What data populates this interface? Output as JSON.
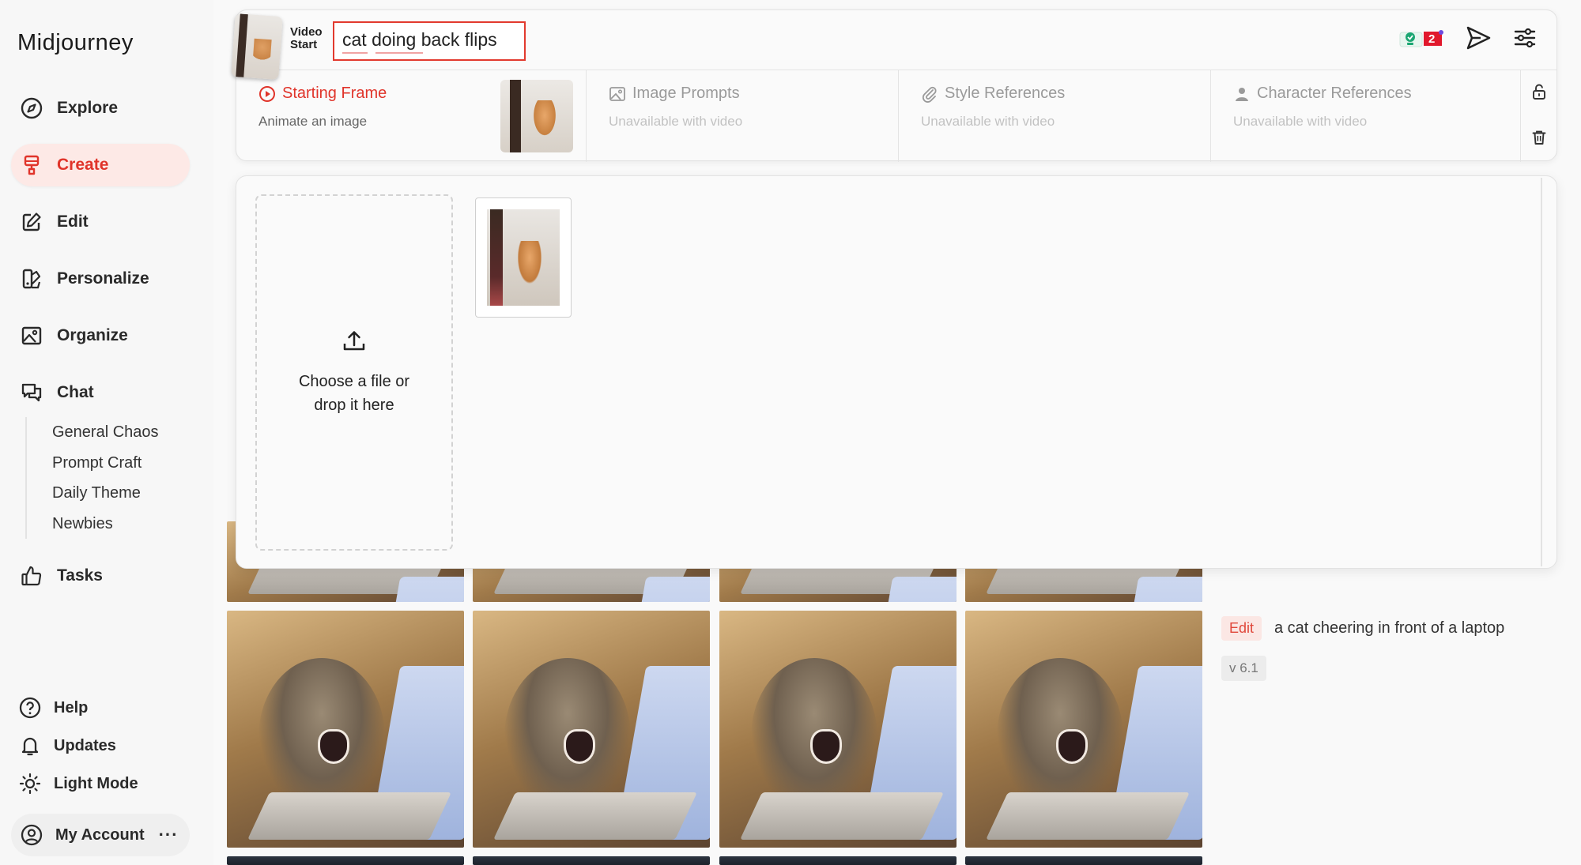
{
  "app": {
    "logo": "Midjourney"
  },
  "sidebar": {
    "items": [
      {
        "label": "Explore",
        "icon": "compass-icon"
      },
      {
        "label": "Create",
        "icon": "paintbrush-icon",
        "active": true
      },
      {
        "label": "Edit",
        "icon": "edit-icon"
      },
      {
        "label": "Personalize",
        "icon": "personalize-icon"
      },
      {
        "label": "Organize",
        "icon": "image-gallery-icon"
      },
      {
        "label": "Chat",
        "icon": "chat-bubbles-icon"
      }
    ],
    "chat_channels": [
      "General Chaos",
      "Prompt Craft",
      "Daily Theme",
      "Newbies"
    ],
    "tasks": {
      "label": "Tasks",
      "icon": "thumbs-up-icon"
    },
    "bottom": [
      {
        "label": "Help",
        "icon": "help-icon"
      },
      {
        "label": "Updates",
        "icon": "bell-icon"
      },
      {
        "label": "Light Mode",
        "icon": "sun-icon"
      }
    ],
    "account": {
      "label": "My Account",
      "more": "···"
    }
  },
  "prompt_bar": {
    "video_label_line1": "Video",
    "video_label_line2": "Start",
    "prompt_value": "cat doing back flips",
    "badge_count": "2",
    "accent_color": "#e0342a"
  },
  "references": {
    "starting_frame": {
      "title": "Starting Frame",
      "subtitle": "Animate an image"
    },
    "image_prompts": {
      "title": "Image Prompts",
      "subtitle": "Unavailable with video"
    },
    "style_references": {
      "title": "Style References",
      "subtitle": "Unavailable with video"
    },
    "character_references": {
      "title": "Character References",
      "subtitle": "Unavailable with video"
    }
  },
  "upload": {
    "line1": "Choose a file or",
    "line2": "drop it here"
  },
  "gallery": {
    "edit_label": "Edit",
    "caption": "a cat cheering in front of a laptop",
    "version": "v 6.1"
  }
}
